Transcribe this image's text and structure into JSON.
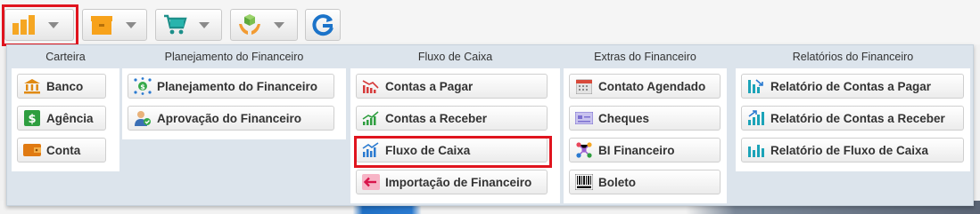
{
  "toolbar": {
    "buttons": [
      {
        "icon": "bar-chart-icon"
      },
      {
        "icon": "box-icon"
      },
      {
        "icon": "shopping-cart-icon"
      },
      {
        "icon": "hands-box-icon"
      },
      {
        "icon": "refresh-icon"
      }
    ]
  },
  "menu": {
    "carteira": {
      "title": "Carteira",
      "items": [
        "Banco",
        "Agência",
        "Conta"
      ]
    },
    "planejamento": {
      "title": "Planejamento do Financeiro",
      "items": [
        "Planejamento do Financeiro",
        "Aprovação do Financeiro"
      ]
    },
    "fluxo": {
      "title": "Fluxo de Caixa",
      "items": [
        "Contas a Pagar",
        "Contas a Receber",
        "Fluxo de Caixa",
        "Importação de Financeiro"
      ]
    },
    "extras": {
      "title": "Extras do Financeiro",
      "items": [
        "Contato Agendado",
        "Cheques",
        "BI Financeiro",
        "Boleto"
      ]
    },
    "relatorios": {
      "title": "Relatórios do Financeiro",
      "items": [
        "Relatório de Contas a Pagar",
        "Relatório de Contas a Receber",
        "Relatório de Fluxo de Caixa"
      ]
    }
  },
  "colors": {
    "highlight": "#e0141e",
    "panel": "#dce4ec"
  }
}
